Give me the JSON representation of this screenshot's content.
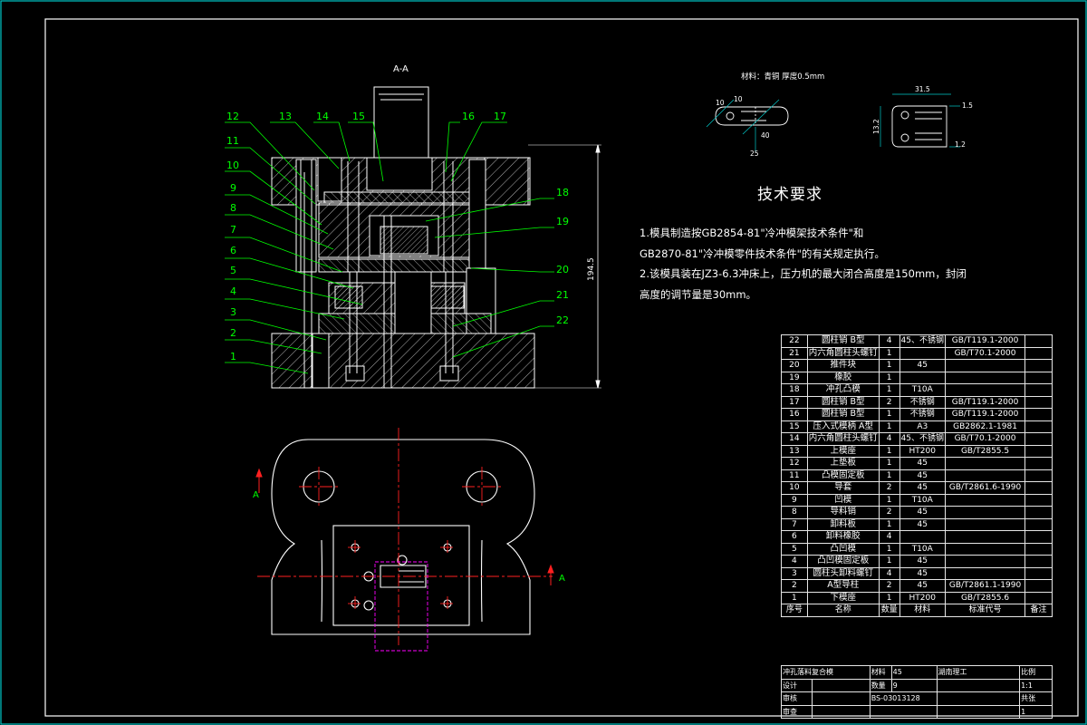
{
  "colors": {
    "background": "#000000",
    "frame": "#00c8c8",
    "callout": "#00ff00",
    "line": "#ffffff",
    "center": "#ff2020",
    "hidden": "#ff00ff",
    "yellow": "#ffff00"
  },
  "section_label": "A-A",
  "section_arrow_label": "A",
  "dimension_height": "194.5",
  "part_numbers": [
    "1",
    "2",
    "3",
    "4",
    "5",
    "6",
    "7",
    "8",
    "9",
    "10",
    "11",
    "12",
    "13",
    "14",
    "15",
    "16",
    "17",
    "18",
    "19",
    "20",
    "21",
    "22"
  ],
  "material_note": "材料：青铜 厚度0.5mm",
  "strip_dims": {
    "d1": "10",
    "d2": "10",
    "d3": "40",
    "d4": "25"
  },
  "part_dims": {
    "w": "31.5",
    "h": "13.2",
    "t1": "1.5",
    "t2": "1.2"
  },
  "tech_title": "技术要求",
  "tech_lines": [
    "1.模具制造按GB2854-81\"冷冲模架技术条件\"和",
    "GB2870-81\"冷冲模零件技术条件\"的有关规定执行。",
    "2.该模具装在JZ3-6.3冲床上，压力机的最大闭合高度是150mm，封闭",
    "高度的调节量是30mm。"
  ],
  "bom_rows": [
    [
      "22",
      "圆柱销 B型",
      "4",
      "45、不锈钢",
      "GB/T119.1-2000",
      ""
    ],
    [
      "21",
      "内六角圆柱头螺钉",
      "1",
      "",
      "GB/T70.1-2000",
      ""
    ],
    [
      "20",
      "推件块",
      "1",
      "45",
      "",
      ""
    ],
    [
      "19",
      "橡胶",
      "1",
      "",
      "",
      ""
    ],
    [
      "18",
      "冲孔凸模",
      "1",
      "T10A",
      "",
      ""
    ],
    [
      "17",
      "圆柱销 B型",
      "2",
      "不锈钢",
      "GB/T119.1-2000",
      ""
    ],
    [
      "16",
      "圆柱销 B型",
      "1",
      "不锈钢",
      "GB/T119.1-2000",
      ""
    ],
    [
      "15",
      "压入式模柄 A型",
      "1",
      "A3",
      "GB2862.1-1981",
      ""
    ],
    [
      "14",
      "内六角圆柱头螺钉",
      "4",
      "45、不锈钢",
      "GB/T70.1-2000",
      ""
    ],
    [
      "13",
      "上模座",
      "1",
      "HT200",
      "GB/T2855.5",
      ""
    ],
    [
      "12",
      "上垫板",
      "1",
      "45",
      "",
      ""
    ],
    [
      "11",
      "凸模固定板",
      "1",
      "45",
      "",
      ""
    ],
    [
      "10",
      "导套",
      "2",
      "45",
      "GB/T2861.6-1990",
      ""
    ],
    [
      "9",
      "凹模",
      "1",
      "T10A",
      "",
      ""
    ],
    [
      "8",
      "导料销",
      "2",
      "45",
      "",
      ""
    ],
    [
      "7",
      "卸料板",
      "1",
      "45",
      "",
      ""
    ],
    [
      "6",
      "卸料橡胶",
      "4",
      "",
      "",
      ""
    ],
    [
      "5",
      "凸凹模",
      "1",
      "T10A",
      "",
      ""
    ],
    [
      "4",
      "凸凹模固定板",
      "1",
      "45",
      "",
      ""
    ],
    [
      "3",
      "圆柱头卸料螺钉",
      "4",
      "45",
      "",
      ""
    ],
    [
      "2",
      "A型导柱",
      "2",
      "45",
      "GB/T2861.1-1990",
      ""
    ],
    [
      "1",
      "下模座",
      "1",
      "HT200",
      "GB/T2855.6",
      ""
    ]
  ],
  "bom_header": [
    "序号",
    "名称",
    "数量",
    "材料",
    "标准代号",
    "备注"
  ],
  "title_block": {
    "drawing_name": "冲孔落料复合模",
    "material_label": "材料",
    "material_value": "45",
    "quantity_label": "数量",
    "quantity_value": "9",
    "scale_label": "比例",
    "scale_value": "1:1",
    "sheet_label": "共张",
    "sheet_value": "1",
    "designer": "设计",
    "checker": "审核",
    "approver": "审查",
    "drawing_code": "BS-03013128",
    "school": "湖南理工"
  }
}
